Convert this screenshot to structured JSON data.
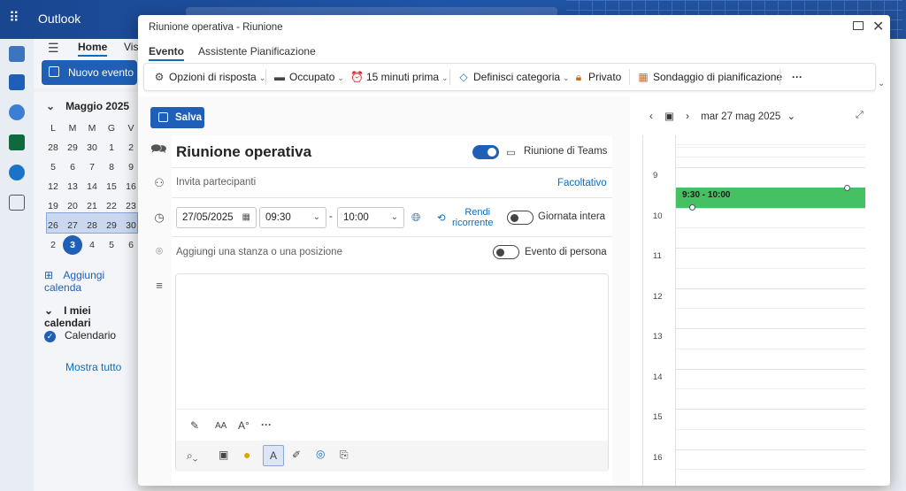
{
  "app": {
    "name": "Outlook"
  },
  "background": {
    "tabs": {
      "home": "Home",
      "view": "Vis"
    },
    "new_event_label": "Nuovo evento",
    "minical": {
      "month": "Maggio 2025",
      "dows": [
        "L",
        "M",
        "M",
        "G",
        "V"
      ],
      "weeks": [
        [
          "28",
          "29",
          "30",
          "1",
          "2"
        ],
        [
          "5",
          "6",
          "7",
          "8",
          "9"
        ],
        [
          "12",
          "13",
          "14",
          "15",
          "16"
        ],
        [
          "19",
          "20",
          "21",
          "22",
          "23"
        ],
        [
          "26",
          "27",
          "28",
          "29",
          "30"
        ],
        [
          "2",
          "3",
          "4",
          "5",
          "6"
        ]
      ],
      "today": "3"
    },
    "add_calendar": "Aggiungi calenda",
    "my_calendars": "I miei calendari",
    "calendar_item": "Calendario",
    "show_all": "Mostra tutto"
  },
  "modal": {
    "title": "Riunione operativa - Riunione",
    "tabs": [
      "Evento",
      "Assistente Pianificazione"
    ],
    "toolbar": {
      "response_options": "Opzioni di risposta",
      "busy": "Occupato",
      "reminder": "15 minuti prima",
      "category": "Definisci categoria",
      "private": "Privato",
      "poll": "Sondaggio di pianificazione",
      "more": "···"
    },
    "save_label": "Salva",
    "event_title": "Riunione operativa",
    "teams_label": "Riunione di Teams",
    "teams_on": true,
    "invite_placeholder": "Invita partecipanti",
    "optional_link": "Facoltativo",
    "date": "27/05/2025",
    "start_time": "09:30",
    "end_time": "10:00",
    "time_separator": "-",
    "recurring_line1": "Rendi",
    "recurring_line2": "ricorrente",
    "all_day_label": "Giornata intera",
    "location_placeholder": "Aggiungi una stanza o una posizione",
    "in_person_label": "Evento di persona",
    "editor_more": "···"
  },
  "calendar": {
    "date_label": "mar 27 mag 2025",
    "hours": [
      "9",
      "10",
      "11",
      "12",
      "13",
      "14",
      "15",
      "16"
    ],
    "event": {
      "label": "9:30 - 10:00",
      "color": "#45c063"
    }
  },
  "colors": {
    "accent": "#1f5fb5",
    "topbar": "#1f4e9a"
  }
}
